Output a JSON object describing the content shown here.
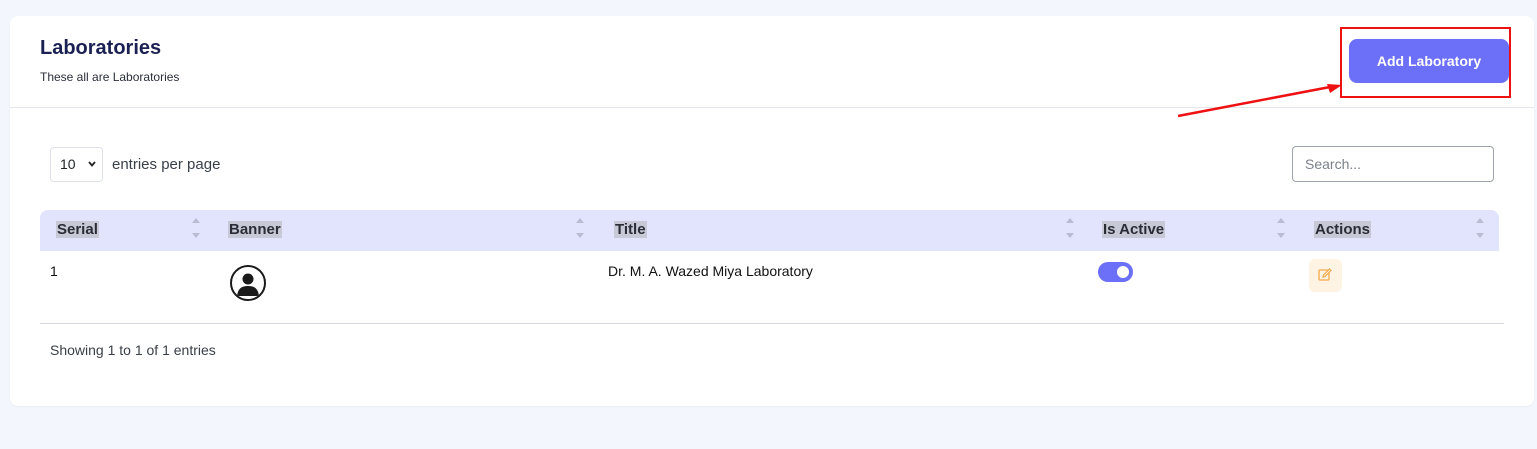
{
  "header": {
    "title": "Laboratories",
    "subtitle": "These all are Laboratories",
    "add_button_label": "Add Laboratory"
  },
  "controls": {
    "per_page_value": "10",
    "per_page_label": "entries per page",
    "search_placeholder": "Search..."
  },
  "table": {
    "columns": [
      "Serial",
      "Banner",
      "Title",
      "Is Active",
      "Actions"
    ],
    "rows": [
      {
        "serial": "1",
        "banner_icon": "user-avatar-icon",
        "title": "Dr. M. A. Wazed Miya Laboratory",
        "is_active": true,
        "action_icon": "edit-icon"
      }
    ]
  },
  "footer": {
    "info": "Showing 1 to 1 of 1 entries"
  },
  "colors": {
    "accent": "#6c6ff7",
    "header_bg": "#e2e4fd",
    "edit_bg": "#fff3e3",
    "edit_icon": "#f4a94a",
    "annotation": "#ee1111"
  }
}
